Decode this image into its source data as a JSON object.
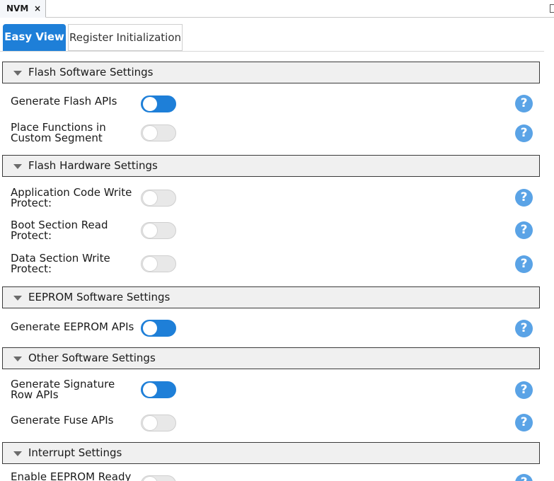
{
  "doc_tab": {
    "label": "NVM",
    "close": "×"
  },
  "view_tabs": {
    "easy": "Easy View",
    "register": "Register Initialization"
  },
  "sections": {
    "flash_sw": "Flash Software Settings",
    "flash_hw": "Flash Hardware Settings",
    "eeprom_sw": "EEPROM Software Settings",
    "other_sw": "Other Software Settings",
    "interrupt": "Interrupt Settings"
  },
  "settings": {
    "gen_flash_apis": {
      "l1": "Generate Flash APIs",
      "l2": "",
      "on": true
    },
    "place_funcs": {
      "l1": "Place Functions in",
      "l2": "Custom Segment",
      "on": false
    },
    "app_code_wp": {
      "l1": "Application Code Write",
      "l2": "Protect:",
      "on": false
    },
    "boot_rp": {
      "l1": "Boot Section Read",
      "l2": "Protect:",
      "on": false
    },
    "data_wp": {
      "l1": "Data Section Write",
      "l2": "Protect:",
      "on": false
    },
    "gen_eeprom_apis": {
      "l1": "Generate EEPROM APIs",
      "l2": "",
      "on": true
    },
    "gen_sig_row": {
      "l1": "Generate Signature",
      "l2": "Row APIs",
      "on": true
    },
    "gen_fuse": {
      "l1": "Generate Fuse APIs",
      "l2": "",
      "on": false
    },
    "eeprom_ready": {
      "l1": "Enable EEPROM Ready",
      "l2": "",
      "on": false
    }
  },
  "help_glyph": "?",
  "colors": {
    "accent": "#1e7fd8",
    "help": "#5aa3e6",
    "header_bg": "#f0f0f0"
  }
}
